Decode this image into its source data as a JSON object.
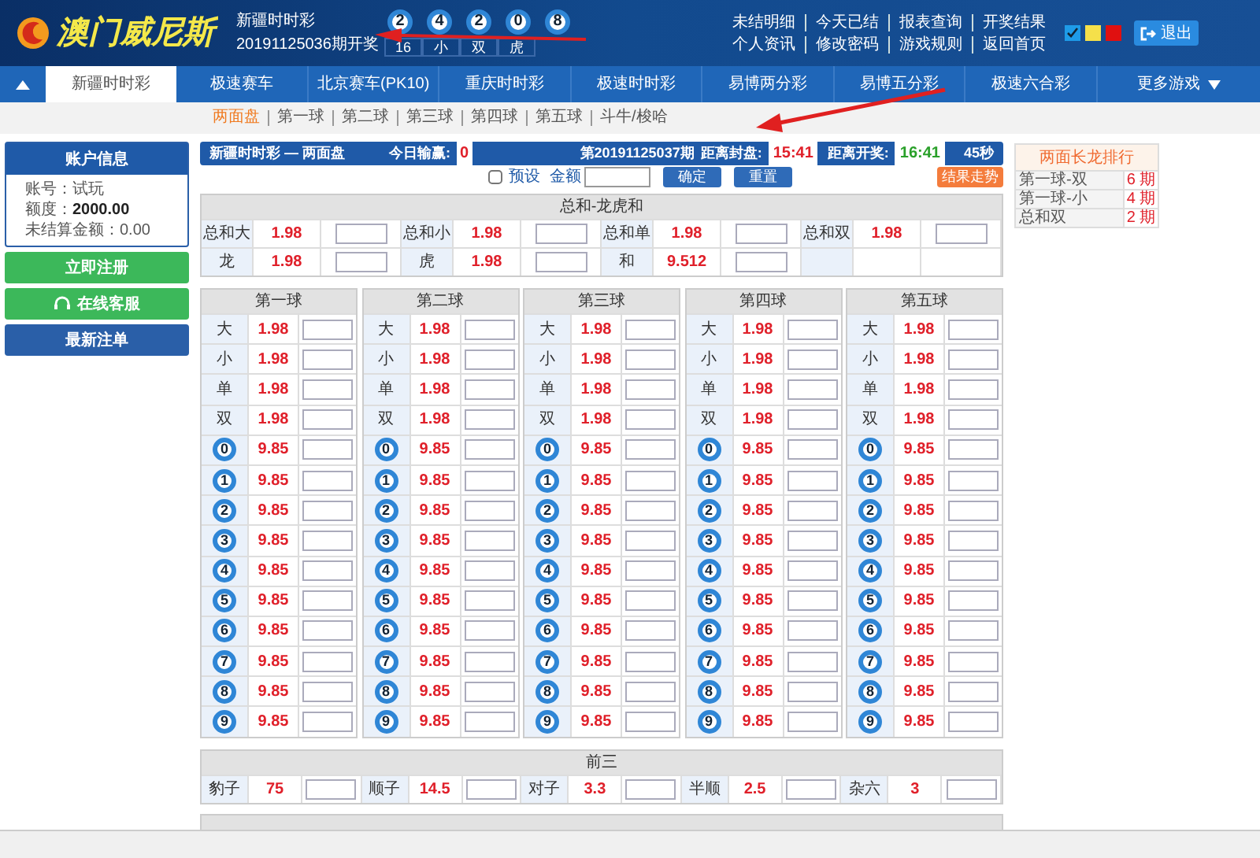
{
  "header": {
    "logo_text": "澳门威尼斯",
    "game": "新疆时时彩",
    "draw": "20191125036期开奖",
    "balls": [
      "2",
      "4",
      "2",
      "0",
      "8"
    ],
    "tags": [
      "16",
      "小",
      "双",
      "虎"
    ],
    "links": [
      [
        "未结明细",
        "今天已结",
        "报表查询",
        "开奖结果"
      ],
      [
        "个人资讯",
        "修改密码",
        "游戏规则",
        "返回首页"
      ]
    ],
    "themes": [
      {
        "color": "#1e9be8",
        "selected": true
      },
      {
        "color": "#f5e04a",
        "selected": false
      },
      {
        "color": "#e01010",
        "selected": false
      }
    ],
    "logout": "退出"
  },
  "nav": [
    {
      "label": "新疆时时彩",
      "selected": true
    },
    {
      "label": "极速赛车",
      "selected": false
    },
    {
      "label": "北京赛车(PK10)",
      "selected": false
    },
    {
      "label": "重庆时时彩",
      "selected": false
    },
    {
      "label": "极速时时彩",
      "selected": false
    },
    {
      "label": "易博两分彩",
      "selected": false
    },
    {
      "label": "易博五分彩",
      "selected": false
    },
    {
      "label": "极速六合彩",
      "selected": false
    },
    {
      "label": "更多游戏",
      "selected": false
    }
  ],
  "subnav": [
    {
      "label": "两面盘",
      "selected": true
    },
    {
      "label": "第一球",
      "selected": false
    },
    {
      "label": "第二球",
      "selected": false
    },
    {
      "label": "第三球",
      "selected": false
    },
    {
      "label": "第四球",
      "selected": false
    },
    {
      "label": "第五球",
      "selected": false
    },
    {
      "label": "斗牛/梭哈",
      "selected": false
    }
  ],
  "account": {
    "title": "账户信息",
    "lines": [
      {
        "label": "账号：",
        "value": "试玩"
      },
      {
        "label": "额度：",
        "value": "2000.00"
      },
      {
        "label": "未结算金额：",
        "value": "0.00"
      }
    ]
  },
  "side_buttons": [
    {
      "label": "立即注册",
      "kind": "green"
    },
    {
      "label": "在线客服",
      "kind": "support"
    },
    {
      "label": "最新注单",
      "kind": "blue"
    }
  ],
  "bar": {
    "title": "新疆时时彩 — 两面盘",
    "winloss_label": "今日输赢:",
    "winloss": "0",
    "period": "第20191125037期",
    "close_label": "距离封盘:",
    "close_time": "15:41",
    "open_label": "距离开奖:",
    "open_time": "16:41",
    "seconds": "45秒"
  },
  "controls": {
    "preset_label": "预设",
    "preset_checked": false,
    "amount_label": "金额",
    "confirm": "确定",
    "reset": "重置",
    "trend": "结果走势"
  },
  "sum_table": {
    "title": "总和-龙虎和",
    "rows": [
      [
        {
          "label": "总和大",
          "odds": "1.98"
        },
        {
          "label": "总和小",
          "odds": "1.98"
        },
        {
          "label": "总和单",
          "odds": "1.98"
        },
        {
          "label": "总和双",
          "odds": "1.98"
        }
      ],
      [
        {
          "label": "龙",
          "odds": "1.98"
        },
        {
          "label": "虎",
          "odds": "1.98"
        },
        {
          "label": "和",
          "odds": "9.512"
        }
      ]
    ]
  },
  "ball_tables": [
    {
      "title": "第一球",
      "rows": [
        {
          "kind": "text",
          "label": "大",
          "odds": "1.98"
        },
        {
          "kind": "text",
          "label": "小",
          "odds": "1.98"
        },
        {
          "kind": "text",
          "label": "单",
          "odds": "1.98"
        },
        {
          "kind": "text",
          "label": "双",
          "odds": "1.98"
        },
        {
          "kind": "ball",
          "label": "0",
          "odds": "9.85"
        },
        {
          "kind": "ball",
          "label": "1",
          "odds": "9.85"
        },
        {
          "kind": "ball",
          "label": "2",
          "odds": "9.85"
        },
        {
          "kind": "ball",
          "label": "3",
          "odds": "9.85"
        },
        {
          "kind": "ball",
          "label": "4",
          "odds": "9.85"
        },
        {
          "kind": "ball",
          "label": "5",
          "odds": "9.85"
        },
        {
          "kind": "ball",
          "label": "6",
          "odds": "9.85"
        },
        {
          "kind": "ball",
          "label": "7",
          "odds": "9.85"
        },
        {
          "kind": "ball",
          "label": "8",
          "odds": "9.85"
        },
        {
          "kind": "ball",
          "label": "9",
          "odds": "9.85"
        }
      ]
    },
    {
      "title": "第二球",
      "rows": [
        {
          "kind": "text",
          "label": "大",
          "odds": "1.98"
        },
        {
          "kind": "text",
          "label": "小",
          "odds": "1.98"
        },
        {
          "kind": "text",
          "label": "单",
          "odds": "1.98"
        },
        {
          "kind": "text",
          "label": "双",
          "odds": "1.98"
        },
        {
          "kind": "ball",
          "label": "0",
          "odds": "9.85"
        },
        {
          "kind": "ball",
          "label": "1",
          "odds": "9.85"
        },
        {
          "kind": "ball",
          "label": "2",
          "odds": "9.85"
        },
        {
          "kind": "ball",
          "label": "3",
          "odds": "9.85"
        },
        {
          "kind": "ball",
          "label": "4",
          "odds": "9.85"
        },
        {
          "kind": "ball",
          "label": "5",
          "odds": "9.85"
        },
        {
          "kind": "ball",
          "label": "6",
          "odds": "9.85"
        },
        {
          "kind": "ball",
          "label": "7",
          "odds": "9.85"
        },
        {
          "kind": "ball",
          "label": "8",
          "odds": "9.85"
        },
        {
          "kind": "ball",
          "label": "9",
          "odds": "9.85"
        }
      ]
    },
    {
      "title": "第三球",
      "rows": [
        {
          "kind": "text",
          "label": "大",
          "odds": "1.98"
        },
        {
          "kind": "text",
          "label": "小",
          "odds": "1.98"
        },
        {
          "kind": "text",
          "label": "单",
          "odds": "1.98"
        },
        {
          "kind": "text",
          "label": "双",
          "odds": "1.98"
        },
        {
          "kind": "ball",
          "label": "0",
          "odds": "9.85"
        },
        {
          "kind": "ball",
          "label": "1",
          "odds": "9.85"
        },
        {
          "kind": "ball",
          "label": "2",
          "odds": "9.85"
        },
        {
          "kind": "ball",
          "label": "3",
          "odds": "9.85"
        },
        {
          "kind": "ball",
          "label": "4",
          "odds": "9.85"
        },
        {
          "kind": "ball",
          "label": "5",
          "odds": "9.85"
        },
        {
          "kind": "ball",
          "label": "6",
          "odds": "9.85"
        },
        {
          "kind": "ball",
          "label": "7",
          "odds": "9.85"
        },
        {
          "kind": "ball",
          "label": "8",
          "odds": "9.85"
        },
        {
          "kind": "ball",
          "label": "9",
          "odds": "9.85"
        }
      ]
    },
    {
      "title": "第四球",
      "rows": [
        {
          "kind": "text",
          "label": "大",
          "odds": "1.98"
        },
        {
          "kind": "text",
          "label": "小",
          "odds": "1.98"
        },
        {
          "kind": "text",
          "label": "单",
          "odds": "1.98"
        },
        {
          "kind": "text",
          "label": "双",
          "odds": "1.98"
        },
        {
          "kind": "ball",
          "label": "0",
          "odds": "9.85"
        },
        {
          "kind": "ball",
          "label": "1",
          "odds": "9.85"
        },
        {
          "kind": "ball",
          "label": "2",
          "odds": "9.85"
        },
        {
          "kind": "ball",
          "label": "3",
          "odds": "9.85"
        },
        {
          "kind": "ball",
          "label": "4",
          "odds": "9.85"
        },
        {
          "kind": "ball",
          "label": "5",
          "odds": "9.85"
        },
        {
          "kind": "ball",
          "label": "6",
          "odds": "9.85"
        },
        {
          "kind": "ball",
          "label": "7",
          "odds": "9.85"
        },
        {
          "kind": "ball",
          "label": "8",
          "odds": "9.85"
        },
        {
          "kind": "ball",
          "label": "9",
          "odds": "9.85"
        }
      ]
    },
    {
      "title": "第五球",
      "rows": [
        {
          "kind": "text",
          "label": "大",
          "odds": "1.98"
        },
        {
          "kind": "text",
          "label": "小",
          "odds": "1.98"
        },
        {
          "kind": "text",
          "label": "单",
          "odds": "1.98"
        },
        {
          "kind": "text",
          "label": "双",
          "odds": "1.98"
        },
        {
          "kind": "ball",
          "label": "0",
          "odds": "9.85"
        },
        {
          "kind": "ball",
          "label": "1",
          "odds": "9.85"
        },
        {
          "kind": "ball",
          "label": "2",
          "odds": "9.85"
        },
        {
          "kind": "ball",
          "label": "3",
          "odds": "9.85"
        },
        {
          "kind": "ball",
          "label": "4",
          "odds": "9.85"
        },
        {
          "kind": "ball",
          "label": "5",
          "odds": "9.85"
        },
        {
          "kind": "ball",
          "label": "6",
          "odds": "9.85"
        },
        {
          "kind": "ball",
          "label": "7",
          "odds": "9.85"
        },
        {
          "kind": "ball",
          "label": "8",
          "odds": "9.85"
        },
        {
          "kind": "ball",
          "label": "9",
          "odds": "9.85"
        }
      ]
    }
  ],
  "front_three": {
    "title": "前三",
    "items": [
      {
        "label": "豹子",
        "odds": "75"
      },
      {
        "label": "顺子",
        "odds": "14.5"
      },
      {
        "label": "对子",
        "odds": "3.3"
      },
      {
        "label": "半顺",
        "odds": "2.5"
      },
      {
        "label": "杂六",
        "odds": "3"
      }
    ]
  },
  "ranking": {
    "title": "两面长龙排行",
    "rows": [
      {
        "name": "第一球-双",
        "count": "6 期"
      },
      {
        "name": "第一球-小",
        "count": "4 期"
      },
      {
        "name": "总和双",
        "count": "2 期"
      }
    ]
  }
}
